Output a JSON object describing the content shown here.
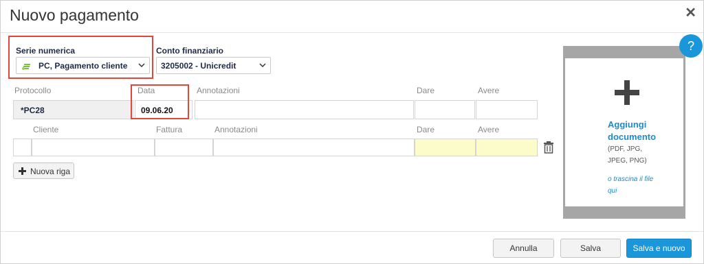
{
  "dialog": {
    "title": "Nuovo pagamento",
    "close_symbol": "✕",
    "help_symbol": "?"
  },
  "serie": {
    "label": "Serie numerica",
    "value": "PC, Pagamento cliente"
  },
  "conto": {
    "label": "Conto finanziario",
    "value": "3205002 - Unicredit"
  },
  "header_columns": {
    "protocollo": "Protocollo",
    "data": "Data",
    "annotazioni": "Annotazioni",
    "dare": "Dare",
    "avere": "Avere"
  },
  "header_row": {
    "protocollo": "*PC28",
    "data": "09.06.20",
    "annotazioni": "",
    "dare": "",
    "avere": ""
  },
  "detail_columns": {
    "cliente": "Cliente",
    "fattura": "Fattura",
    "annotazioni": "Annotazioni",
    "dare": "Dare",
    "avere": "Avere"
  },
  "add_row_button": "Nuova riga",
  "upload": {
    "title_line1": "Aggiungi",
    "title_line2": "documento",
    "formats_line1": "(PDF, JPG,",
    "formats_line2": "JPEG, PNG)",
    "drag_line1": "o trascina il file",
    "drag_line2": "qui"
  },
  "footer": {
    "cancel": "Annulla",
    "save": "Salva",
    "save_new": "Salva e nuovo"
  },
  "colors": {
    "accent": "#1a96db",
    "highlight": "#e0463c",
    "yellow": "#fbfcc9"
  }
}
